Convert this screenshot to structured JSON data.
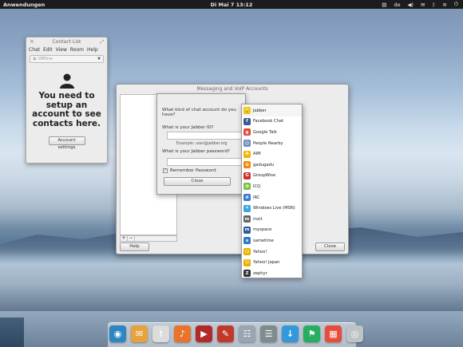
{
  "top_panel": {
    "apps_label": "Anwendungen",
    "clock": "Di Mai  7 13:12",
    "lang": "de"
  },
  "contact_list": {
    "title": "Contact List",
    "menu": [
      "Chat",
      "Edit",
      "View",
      "Room",
      "Help"
    ],
    "status": "Offline",
    "message": "You need to setup an account to see contacts here.",
    "button": "Account settings"
  },
  "accounts_window": {
    "title": "Messaging and VoIP Accounts",
    "help_button": "Help",
    "close_button": "Close",
    "add_label": "+",
    "remove_label": "−"
  },
  "dialog": {
    "question": "What kind of chat account do you have?",
    "id_label": "What is your Jabber ID?",
    "id_example": "Example: user@jabber.org",
    "password_label": "What is your Jabber password?",
    "remember_label": "Remember Password",
    "close_button": "Close"
  },
  "protocols": [
    {
      "label": "Jabber",
      "icon": "jabber-icon",
      "color": "#f0c419",
      "glyph": "💡"
    },
    {
      "label": "Facebook Chat",
      "icon": "facebook-icon",
      "color": "#3b5998",
      "glyph": "f"
    },
    {
      "label": "Google Talk",
      "icon": "google-talk-icon",
      "color": "#dd4b39",
      "glyph": "g"
    },
    {
      "label": "People Nearby",
      "icon": "people-nearby-icon",
      "color": "#6c8ebf",
      "glyph": "☺"
    },
    {
      "label": "AIM",
      "icon": "aim-icon",
      "color": "#f5b400",
      "glyph": "A"
    },
    {
      "label": "gadugadu",
      "icon": "gadugadu-icon",
      "color": "#f58a00",
      "glyph": "✿"
    },
    {
      "label": "GroupWise",
      "icon": "groupwise-icon",
      "color": "#d0302f",
      "glyph": "G"
    },
    {
      "label": "ICQ",
      "icon": "icq-icon",
      "color": "#7bc043",
      "glyph": "✿"
    },
    {
      "label": "IRC",
      "icon": "irc-icon",
      "color": "#3a7bd5",
      "glyph": "#"
    },
    {
      "label": "Windows Live (MSN)",
      "icon": "msn-icon",
      "color": "#39a9dc",
      "glyph": "✦"
    },
    {
      "label": "mxit",
      "icon": "mxit-icon",
      "color": "#666666",
      "glyph": "m"
    },
    {
      "label": "myspace",
      "icon": "myspace-icon",
      "color": "#2c5d9b",
      "glyph": "m"
    },
    {
      "label": "sametime",
      "icon": "sametime-icon",
      "color": "#2f79c6",
      "glyph": "s"
    },
    {
      "label": "Yahoo!",
      "icon": "yahoo-icon",
      "color": "#e8b000",
      "glyph": "☺"
    },
    {
      "label": "Yahoo! Japan",
      "icon": "yahoo-japan-icon",
      "color": "#e8b000",
      "glyph": "☺"
    },
    {
      "label": "zephyr",
      "icon": "zephyr-icon",
      "color": "#333333",
      "glyph": "Z"
    }
  ],
  "dock": [
    {
      "name": "midori-browser-icon",
      "color": "#2e86c1",
      "glyph": "◉"
    },
    {
      "name": "mail-icon",
      "color": "#e6a23c",
      "glyph": "✉"
    },
    {
      "name": "chat-icon",
      "color": "#dcdcdc",
      "glyph": "!"
    },
    {
      "name": "music-icon",
      "color": "#e8742c",
      "glyph": "♪"
    },
    {
      "name": "video-icon",
      "color": "#b02a2a",
      "glyph": "▶"
    },
    {
      "name": "photos-icon",
      "color": "#c0392b",
      "glyph": "✎"
    },
    {
      "name": "contacts-icon",
      "color": "#9aa5b1",
      "glyph": "☷"
    },
    {
      "name": "settings-icon",
      "color": "#7f8c8d",
      "glyph": "☰"
    },
    {
      "name": "downloads-icon",
      "color": "#3498db",
      "glyph": "↓"
    },
    {
      "name": "software-center-icon",
      "color": "#27ae60",
      "glyph": "⚑"
    },
    {
      "name": "calendar-icon",
      "color": "#e74c3c",
      "glyph": "▦"
    },
    {
      "name": "disc-icon",
      "color": "#bdc3c7",
      "glyph": "◎"
    }
  ]
}
